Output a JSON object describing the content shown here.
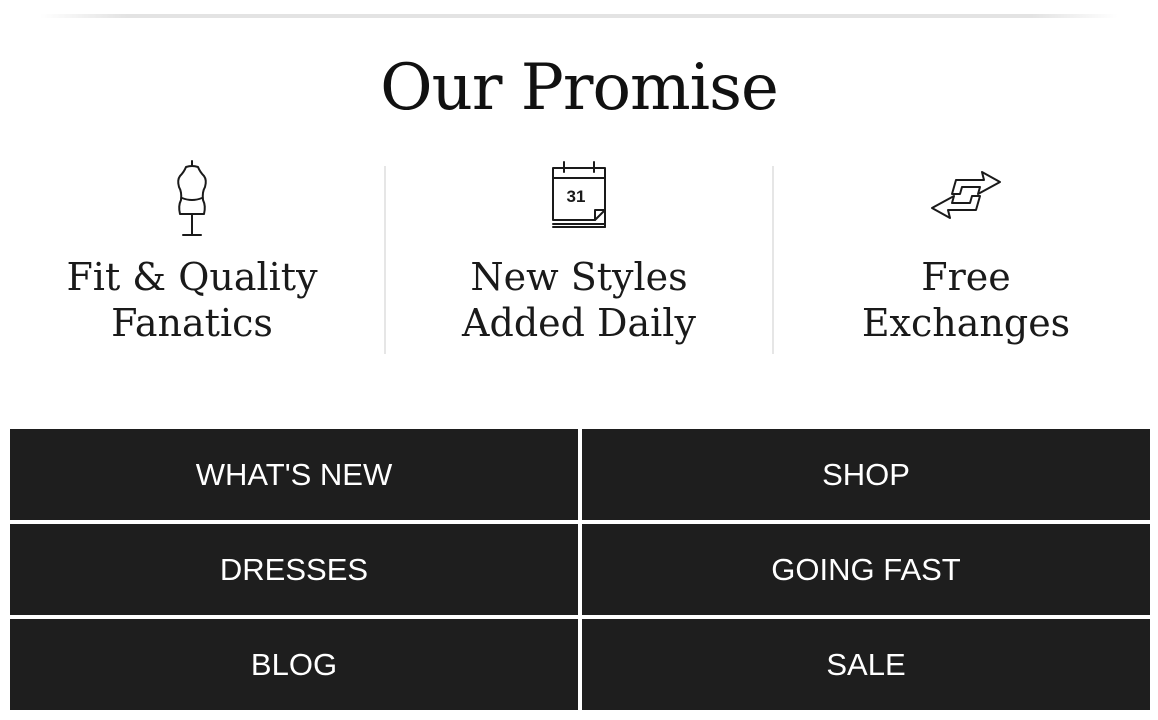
{
  "promise": {
    "title": "Our Promise",
    "features": [
      {
        "icon": "dress-form-icon",
        "label": "Fit & Quality\nFanatics"
      },
      {
        "icon": "calendar-icon",
        "label": "New Styles\nAdded Daily",
        "calendar_day": "31"
      },
      {
        "icon": "exchange-arrows-icon",
        "label": "Free\nExchanges"
      }
    ]
  },
  "nav": {
    "items": [
      {
        "label": "WHAT'S NEW"
      },
      {
        "label": "SHOP"
      },
      {
        "label": "DRESSES"
      },
      {
        "label": "GOING FAST"
      },
      {
        "label": "BLOG"
      },
      {
        "label": "SALE"
      }
    ]
  },
  "colors": {
    "nav_background": "#1e1e1e",
    "nav_text": "#ffffff",
    "text": "#1a1a1a",
    "divider": "#e6e6e6"
  }
}
